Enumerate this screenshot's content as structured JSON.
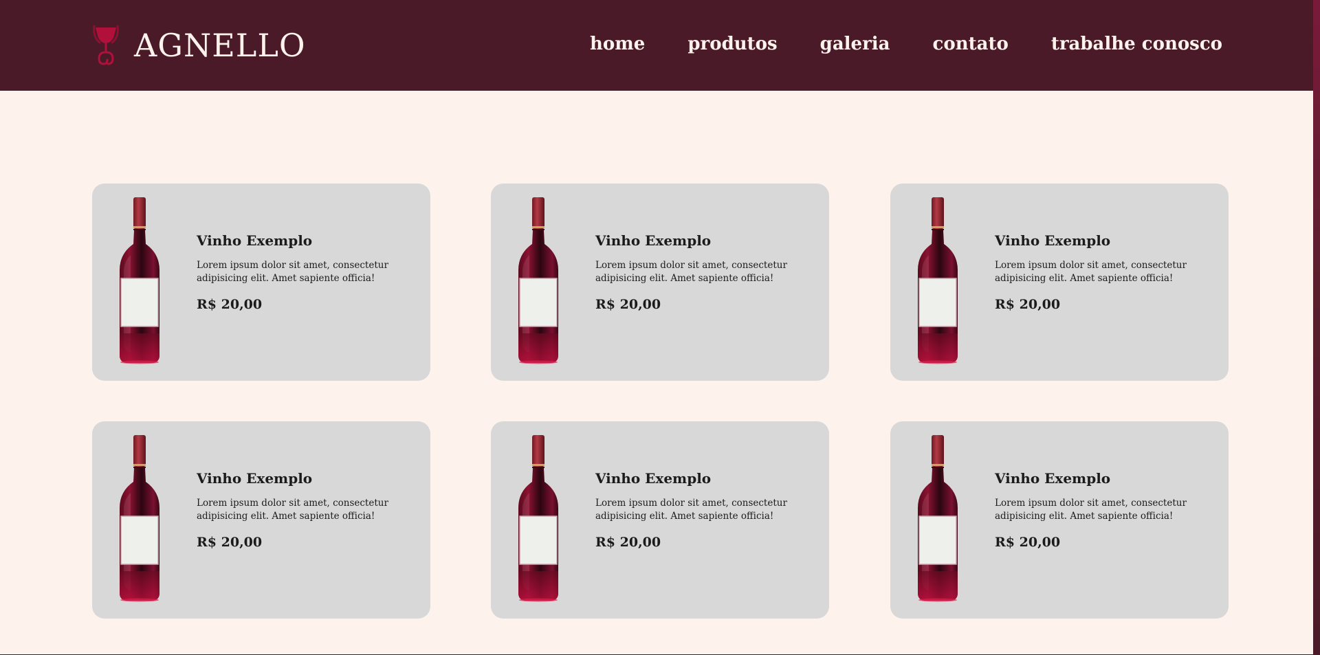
{
  "brand": {
    "name": "AGNELLO",
    "logo_icon": "wine-glass-logo-icon",
    "colors": {
      "header_bg": "#4a1a28",
      "page_bg": "#fdf3ec",
      "card_bg": "#d8d8d8",
      "wine": "#8b1232",
      "logo_accent": "#b0103a"
    }
  },
  "nav": {
    "items": [
      {
        "label": "home"
      },
      {
        "label": "produtos"
      },
      {
        "label": "galeria"
      },
      {
        "label": "contato"
      },
      {
        "label": "trabalhe conosco"
      }
    ]
  },
  "products": [
    {
      "name": "Vinho Exemplo",
      "desc_line1": "Lorem ipsum dolor sit amet, consectetur",
      "desc_line2": "adipisicing elit. Amet sapiente officia!",
      "price": "R$ 20,00",
      "image_icon": "wine-bottle-icon"
    },
    {
      "name": "Vinho Exemplo",
      "desc_line1": "Lorem ipsum dolor sit amet, consectetur",
      "desc_line2": "adipisicing elit. Amet sapiente officia!",
      "price": "R$ 20,00",
      "image_icon": "wine-bottle-icon"
    },
    {
      "name": "Vinho Exemplo",
      "desc_line1": "Lorem ipsum dolor sit amet, consectetur",
      "desc_line2": "adipisicing elit. Amet sapiente officia!",
      "price": "R$ 20,00",
      "image_icon": "wine-bottle-icon"
    },
    {
      "name": "Vinho Exemplo",
      "desc_line1": "Lorem ipsum dolor sit amet, consectetur",
      "desc_line2": "adipisicing elit. Amet sapiente officia!",
      "price": "R$ 20,00",
      "image_icon": "wine-bottle-icon"
    },
    {
      "name": "Vinho Exemplo",
      "desc_line1": "Lorem ipsum dolor sit amet, consectetur",
      "desc_line2": "adipisicing elit. Amet sapiente officia!",
      "price": "R$ 20,00",
      "image_icon": "wine-bottle-icon"
    },
    {
      "name": "Vinho Exemplo",
      "desc_line1": "Lorem ipsum dolor sit amet, consectetur",
      "desc_line2": "adipisicing elit. Amet sapiente officia!",
      "price": "R$ 20,00",
      "image_icon": "wine-bottle-icon"
    }
  ]
}
